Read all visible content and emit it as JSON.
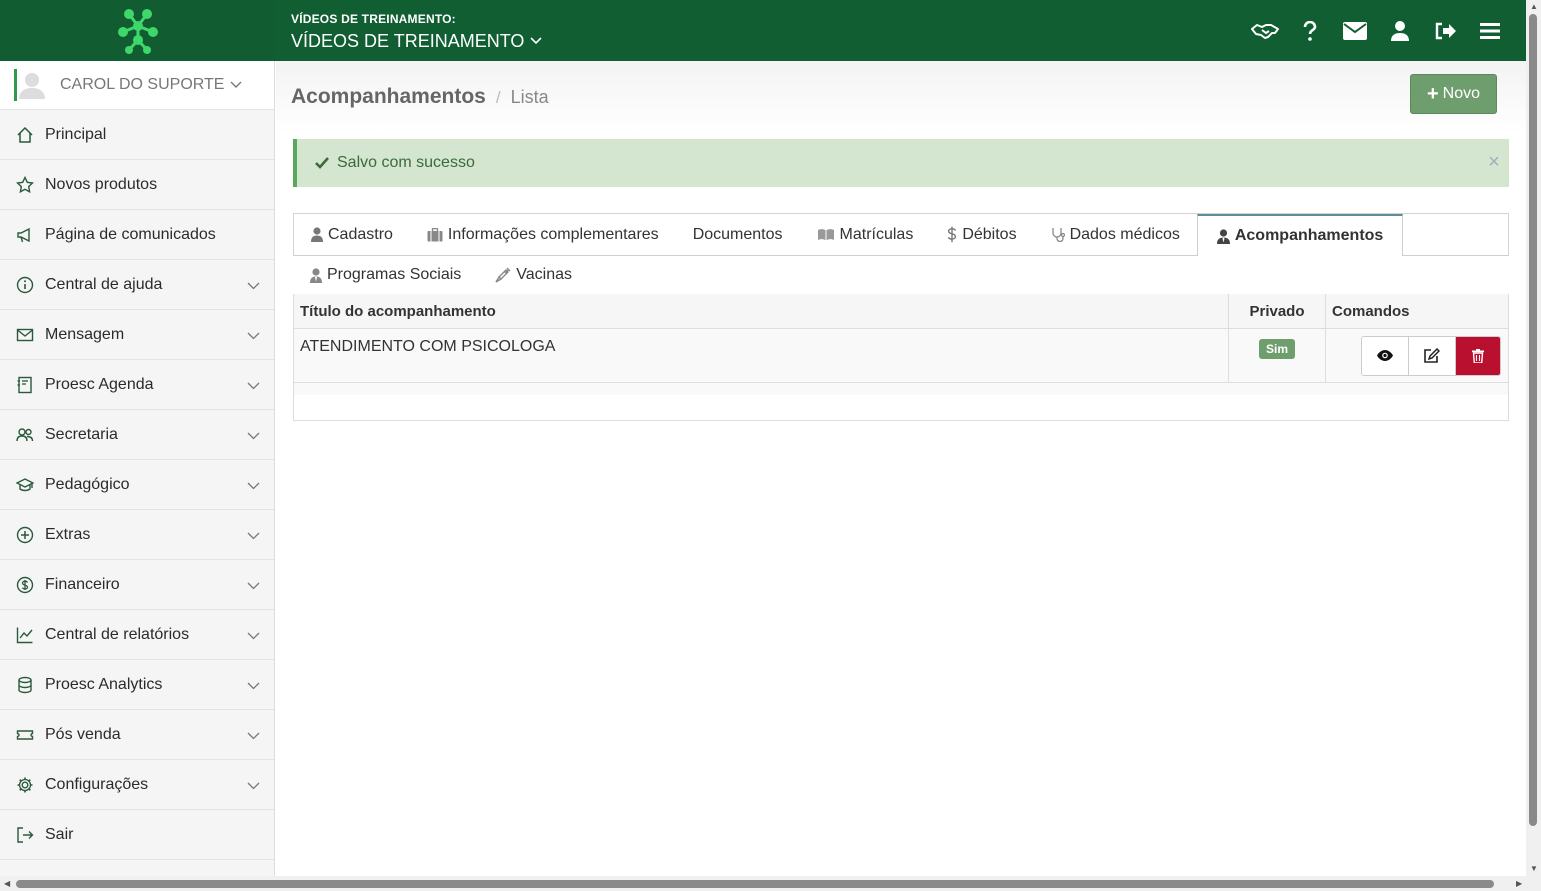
{
  "header": {
    "context_small": "VÍDEOS DE TREINAMENTO:",
    "context_big": "VÍDEOS DE TREINAMENTO",
    "icons": [
      "handshake-icon",
      "help-icon",
      "mail-icon",
      "user-icon",
      "logout-icon",
      "menu-icon"
    ]
  },
  "sidebar": {
    "user_name": "CAROL DO SUPORTE",
    "items": [
      {
        "label": "Principal",
        "icon": "home-icon",
        "expandable": false
      },
      {
        "label": "Novos produtos",
        "icon": "star-icon",
        "expandable": false
      },
      {
        "label": "Página de comunicados",
        "icon": "megaphone-icon",
        "expandable": false
      },
      {
        "label": "Central de ajuda",
        "icon": "info-icon",
        "expandable": true
      },
      {
        "label": "Mensagem",
        "icon": "envelope-icon",
        "expandable": true
      },
      {
        "label": "Proesc Agenda",
        "icon": "agenda-icon",
        "expandable": true
      },
      {
        "label": "Secretaria",
        "icon": "users-icon",
        "expandable": true
      },
      {
        "label": "Pedagógico",
        "icon": "graduation-icon",
        "expandable": true
      },
      {
        "label": "Extras",
        "icon": "plus-circle-icon",
        "expandable": true
      },
      {
        "label": "Financeiro",
        "icon": "dollar-circle-icon",
        "expandable": true
      },
      {
        "label": "Central de relatórios",
        "icon": "line-chart-icon",
        "expandable": true
      },
      {
        "label": "Proesc Analytics",
        "icon": "database-icon",
        "expandable": true
      },
      {
        "label": "Pós venda",
        "icon": "ticket-icon",
        "expandable": true
      },
      {
        "label": "Configurações",
        "icon": "gear-icon",
        "expandable": true
      },
      {
        "label": "Sair",
        "icon": "exit-icon",
        "expandable": false
      }
    ]
  },
  "page": {
    "title": "Acompanhamentos",
    "separator": "/",
    "subtitle": "Lista",
    "new_button": "Novo"
  },
  "alert": {
    "message": "Salvo com sucesso",
    "close": "×"
  },
  "tabs": {
    "row1": [
      {
        "label": "Cadastro",
        "icon": "user-icon"
      },
      {
        "label": "Informações complementares",
        "icon": "briefcase-icon"
      },
      {
        "label": "Documentos",
        "icon": ""
      },
      {
        "label": "Matrículas",
        "icon": "book-icon"
      },
      {
        "label": "Débitos",
        "icon": "dollar-icon"
      },
      {
        "label": "Dados médicos",
        "icon": "stethoscope-icon"
      },
      {
        "label": "Acompanhamentos",
        "icon": "user-tie-icon",
        "active": true
      }
    ],
    "row2": [
      {
        "label": "Programas Sociais",
        "icon": "user-group-icon"
      },
      {
        "label": "Vacinas",
        "icon": "syringe-icon"
      }
    ]
  },
  "table": {
    "headers": [
      "Título do acompanhamento",
      "Privado",
      "Comandos"
    ],
    "rows": [
      {
        "title": "ATENDIMENTO COM PSICOLOGA",
        "private": "Sim"
      }
    ]
  },
  "colors": {
    "topbar": "#115e33",
    "accent_green": "#6e9e6e",
    "alert_bg": "#d4e6cf",
    "danger": "#b8102e"
  }
}
